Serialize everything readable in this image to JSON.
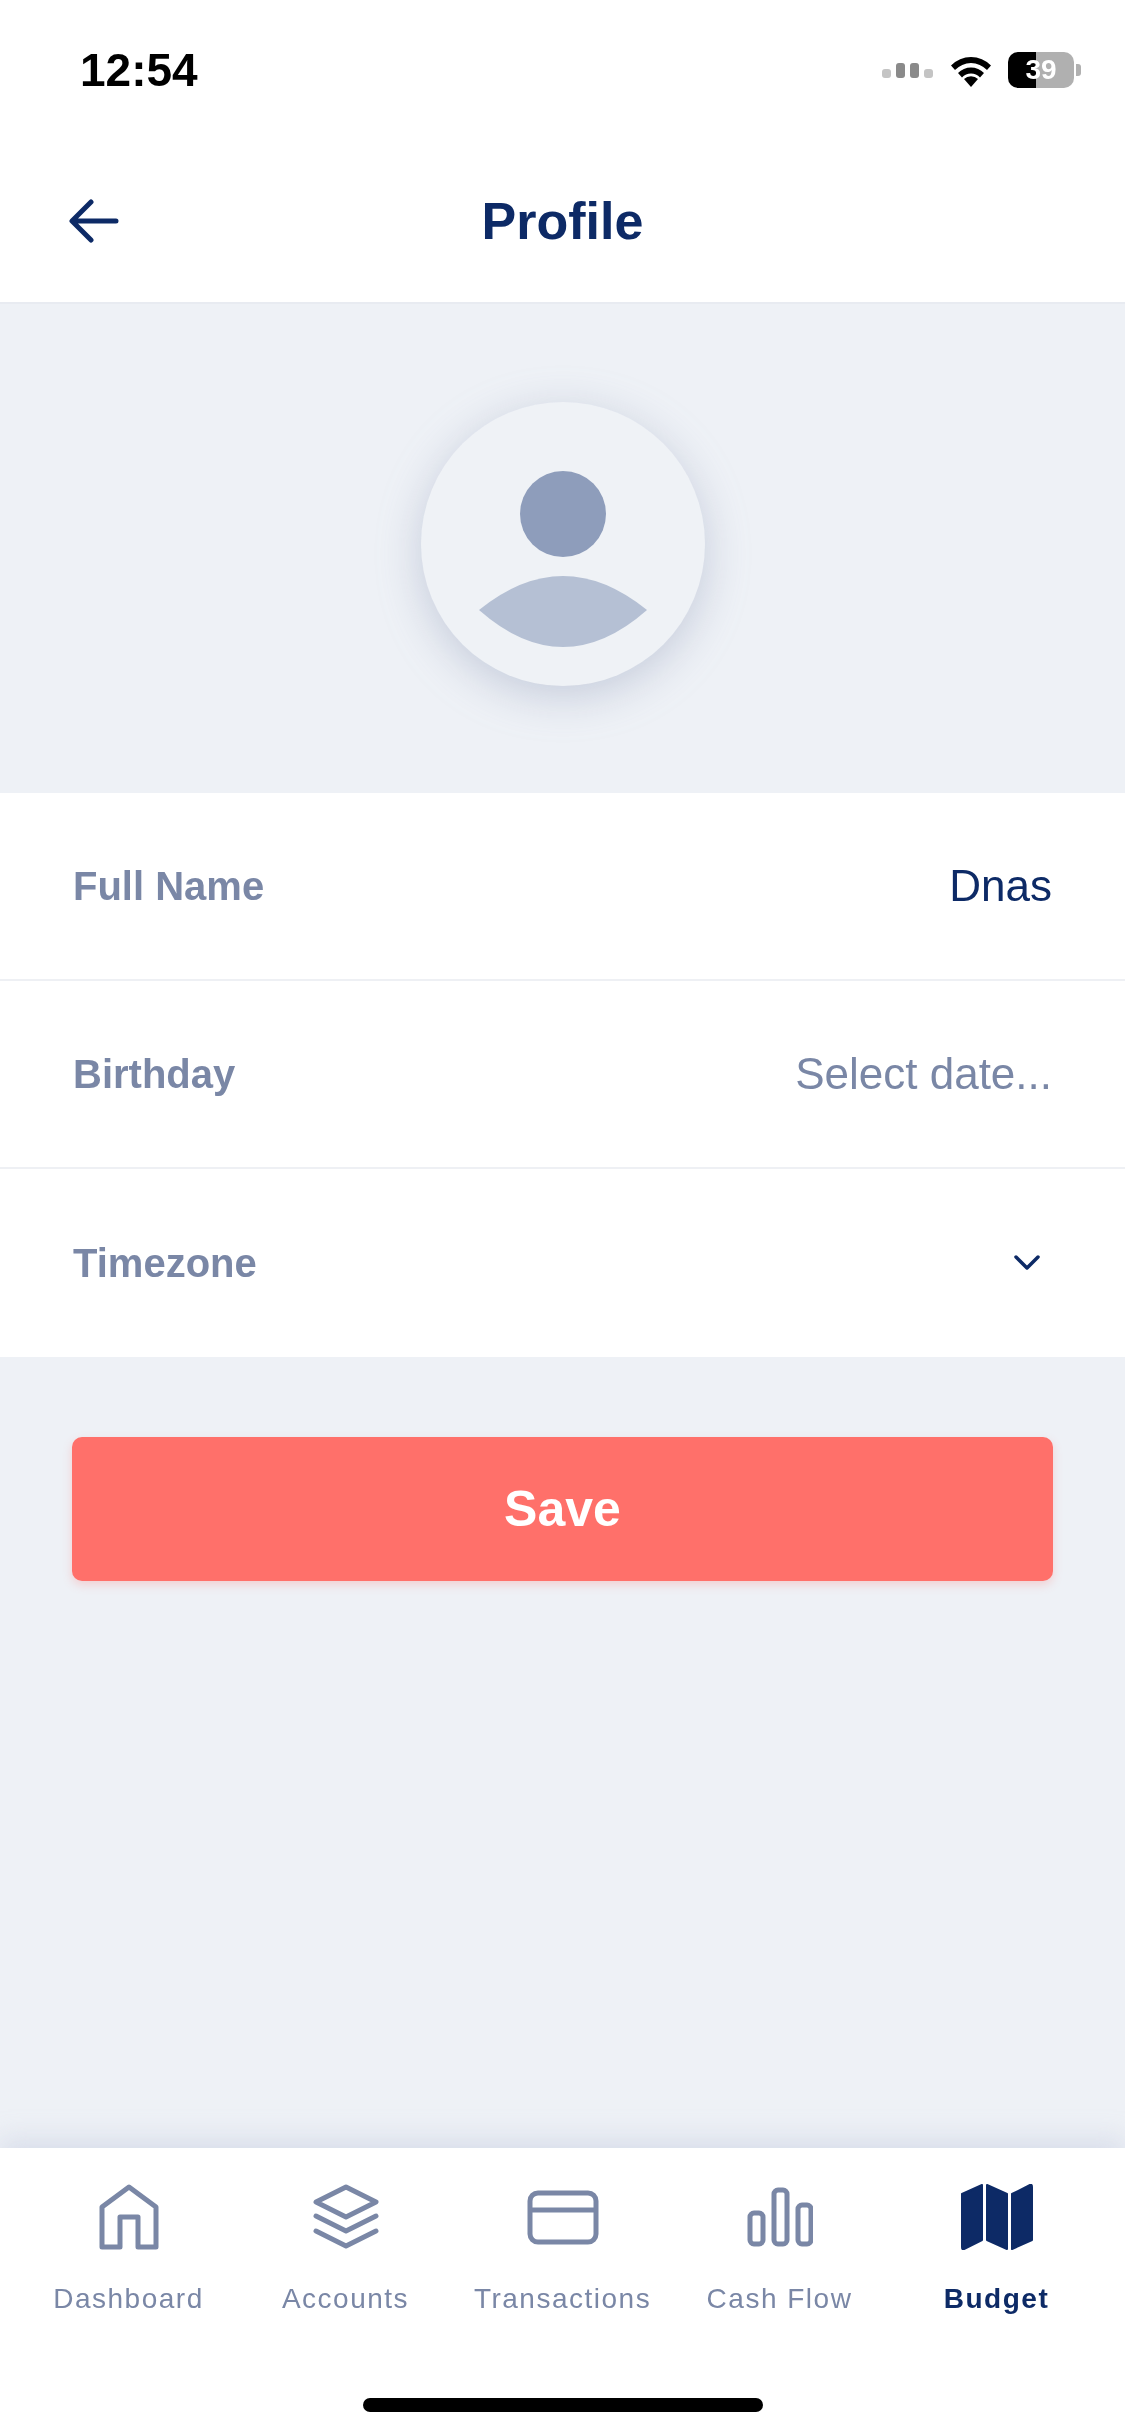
{
  "status_bar": {
    "time": "12:54",
    "battery": "39"
  },
  "header": {
    "title": "Profile"
  },
  "form": {
    "fields": [
      {
        "kind": "text",
        "label": "Full Name",
        "value": "Dnas"
      },
      {
        "kind": "date",
        "label": "Birthday",
        "placeholder": "Select date..."
      },
      {
        "kind": "select",
        "label": "Timezone"
      }
    ]
  },
  "save_button": {
    "label": "Save"
  },
  "tab_bar": {
    "tabs": [
      {
        "label": "Dashboard",
        "selected": false
      },
      {
        "label": "Accounts",
        "selected": false
      },
      {
        "label": "Transactions",
        "selected": false
      },
      {
        "label": "Cash Flow",
        "selected": false
      },
      {
        "label": "Budget",
        "selected": true
      }
    ]
  }
}
